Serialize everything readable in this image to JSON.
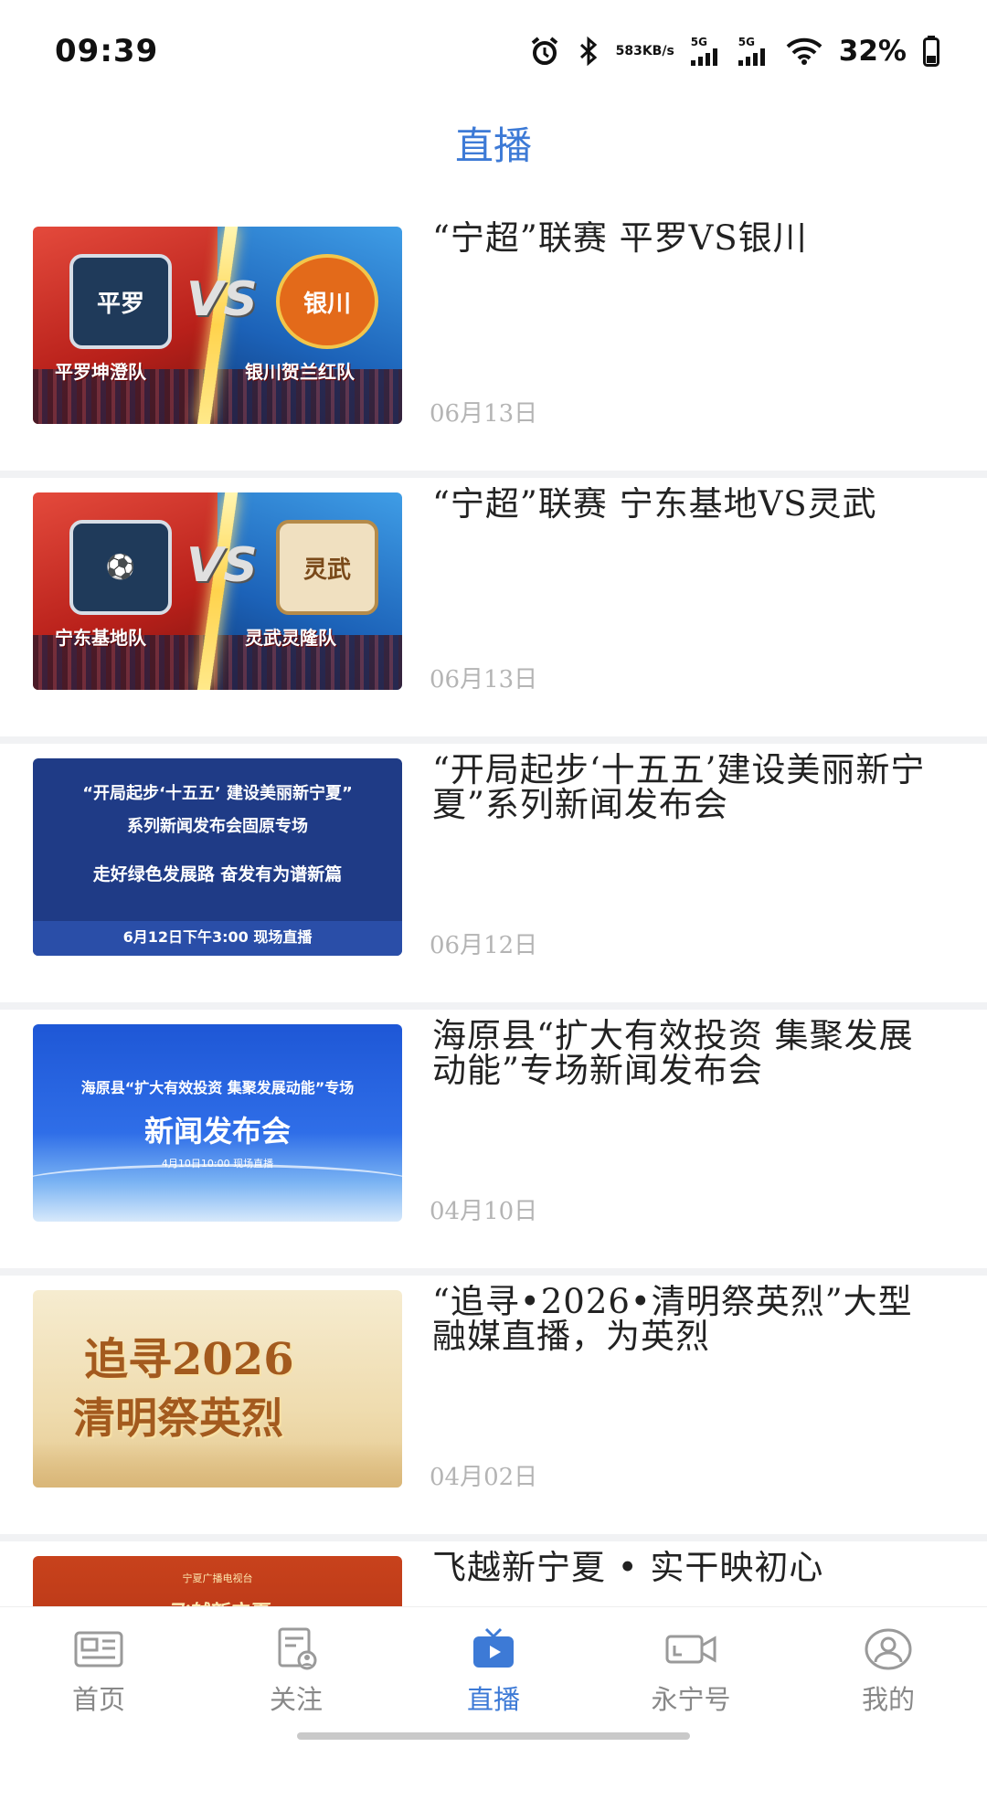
{
  "status_bar": {
    "time": "09:39",
    "net_speed_value": "583",
    "net_speed_unit": "KB/s",
    "sim1_label": "5G",
    "sim2_label": "5G",
    "battery": "32%"
  },
  "header": {
    "title": "直播"
  },
  "items": [
    {
      "title": "“宁超”联赛 平罗VS银川",
      "date": "06月13日",
      "thumb": {
        "left_team_badge": "平罗",
        "right_team_badge": "银川",
        "vs": "VS",
        "left_team": "平罗坤澄队",
        "right_team": "银川贺兰红队"
      }
    },
    {
      "title": "“宁超”联赛 宁东基地VS灵武",
      "date": "06月13日",
      "thumb": {
        "left_team_badge": "⚽",
        "right_team_badge": "灵武",
        "vs": "VS",
        "left_team": "宁东基地队",
        "right_team": "灵武灵隆队"
      }
    },
    {
      "title": "“开局起步‘十五五’建设美丽新宁夏”系列新闻发布会",
      "date": "06月12日",
      "thumb": {
        "line1": "“开局起步‘十五五’ 建设美丽新宁夏”",
        "line2": "系列新闻发布会固原专场",
        "line3": "走好绿色发展路 奋发有为谱新篇",
        "line4": "6月12日下午3:00 现场直播"
      }
    },
    {
      "title": "海原县“扩大有效投资 集聚发展动能”专场新闻发布会",
      "date": "04月10日",
      "thumb": {
        "line1": "海原县“扩大有效投资 集聚发展动能”专场",
        "line2": "新闻发布会",
        "line3": "4月10日10:00 现场直播"
      }
    },
    {
      "title": "“追寻•2026•清明祭英烈”大型融媒直播，为英烈",
      "date": "04月02日",
      "thumb": {
        "line1": "追寻2026",
        "line2": "清明祭英烈"
      }
    },
    {
      "title": "飞越新宁夏 • 实干映初心",
      "date": "",
      "thumb": {
        "line1": "宁夏广播电视台",
        "line2": "飞越新宁夏"
      }
    }
  ],
  "nav": [
    {
      "label": "首页",
      "icon": "news-icon",
      "active": false
    },
    {
      "label": "关注",
      "icon": "follow-icon",
      "active": false
    },
    {
      "label": "直播",
      "icon": "live-tv-icon",
      "active": true
    },
    {
      "label": "永宁号",
      "icon": "video-camera-icon",
      "active": false
    },
    {
      "label": "我的",
      "icon": "profile-icon",
      "active": false
    }
  ],
  "colors": {
    "accent": "#3d7ad6",
    "date": "#b4b4b4",
    "separator": "#f1f2f4",
    "nav_inactive": "#888888"
  }
}
